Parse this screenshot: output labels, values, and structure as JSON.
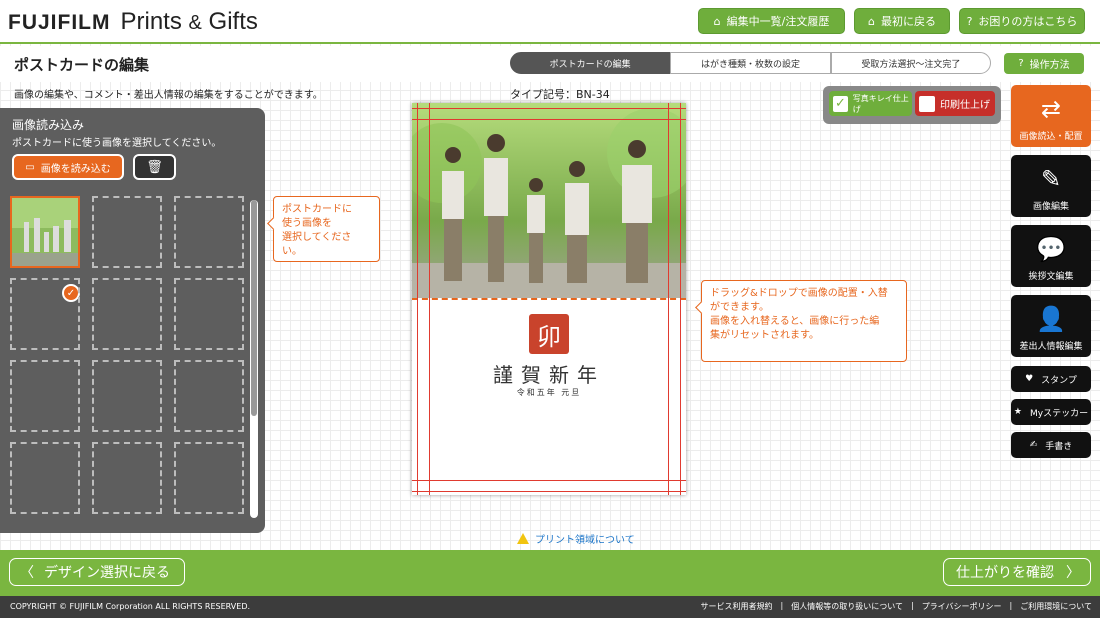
{
  "header": {
    "brand": "FUJIFILM",
    "product": "Prints",
    "amp": "&",
    "gifts": "Gifts",
    "nav": [
      {
        "label": "編集中一覧/注文履歴",
        "icon": "home-icon"
      },
      {
        "label": "最初に戻る",
        "icon": "home-icon"
      },
      {
        "label": "お困りの方はこちら",
        "icon": "question-icon"
      }
    ]
  },
  "page": {
    "title": "ポストカードの編集",
    "description": "画像の編集や、コメント・差出人情報の編集をすることができます。",
    "type_no": "タイプ記号：BN-34",
    "howto": "操作方法"
  },
  "steps": [
    "ポストカードの編集",
    "はがき種類・枚数の設定",
    "受取方法選択〜注文完了"
  ],
  "left_panel": {
    "title": "画像読み込み",
    "description": "ポストカードに使う画像を選択してください。",
    "load_button": "画像を読み込む"
  },
  "tips": {
    "left": "ポストカードに\n使う画像を\n選択してください。",
    "right": "ドラッグ&ドロップで画像の配置・入替\nができます。\n画像を入れ替えると、画像に行った編\n集がリセットされます。"
  },
  "card": {
    "stamp": "卯",
    "greeting": "謹賀新年",
    "date": "令和五年 元旦"
  },
  "finish": {
    "photo": "写真キレイ仕上げ",
    "print": "印刷仕上げ",
    "photo_checked": true,
    "print_checked": false
  },
  "tools": [
    {
      "label": "画像読込・配置",
      "icon": "image-load-icon"
    },
    {
      "label": "画像編集",
      "icon": "image-edit-icon"
    },
    {
      "label": "挨拶文編集",
      "icon": "speech-bubble-icon"
    },
    {
      "label": "差出人情報編集",
      "icon": "person-icon"
    }
  ],
  "small_tools": [
    {
      "label": "スタンプ",
      "icon": "heart-stamp-icon"
    },
    {
      "label": "Myステッカー",
      "icon": "sticker-icon"
    },
    {
      "label": "手書き",
      "icon": "pen-icon"
    }
  ],
  "print_area": "プリント領域について",
  "footer": {
    "back": "デザイン選択に戻る",
    "next": "仕上がりを確認",
    "copyright": "COPYRIGHT © FUJIFILM Corporation ALL RIGHTS RESERVED.",
    "links": [
      "サービス利用者規約",
      "個人情報等の取り扱いについて",
      "プライバシーポリシー",
      "ご利用環境について"
    ]
  }
}
